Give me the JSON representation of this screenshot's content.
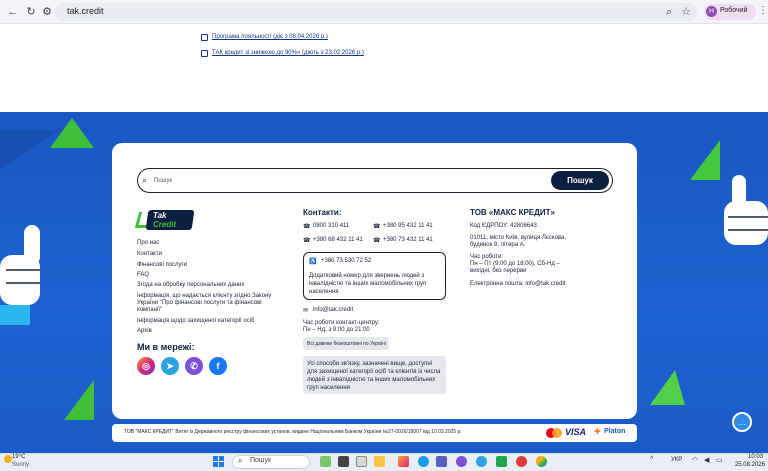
{
  "browser": {
    "url": "tak.credit",
    "profile_initial": "Н",
    "profile_name": "Робочий"
  },
  "top_links": [
    "Програма лояльності (діє з 08.04.2026 р.)",
    "ТАК кредит зі знижкою до 90%» (діють з 23.02.2026 р.)"
  ],
  "search": {
    "placeholder": "Пошук",
    "button_label": "Пошук"
  },
  "logo": {
    "line1": "Tak",
    "line2": "Credit"
  },
  "nav_links": [
    "Про нас",
    "Контакти",
    "Фінансові послуги",
    "FAQ",
    "Згода на обробку персональних даних",
    "Інформація, що надається клієнту згідно Закону України \"Про фінансові послуги та фінансові компанії\"",
    "Інформація щодо захищеної категорії осіб",
    "Архів"
  ],
  "social": {
    "title": "Ми в мережі:",
    "icons": [
      "instagram-icon",
      "telegram-icon",
      "viber-icon",
      "facebook-icon"
    ]
  },
  "contacts": {
    "title": "Контакти:",
    "phones": [
      "0800 310 411",
      "+380 95 432 11 41",
      "+380 68 432 11 41",
      "+380 73 432 11 41"
    ],
    "accessible_phone": "+380 73 530 72 52",
    "accessible_note": "Додатковий номер для звернень людей з інвалідністю та інших маломобільних груп населення",
    "email": "info@tak.credit",
    "hours_label": "Час роботи контакт-центру:",
    "hours": "Пн – Нд, з 9:00 до 21:00",
    "free_calls": "Всі дзвінки безкоштовні по Україні",
    "protected_note": "Усі способи зв'язку, зазначені вище, доступні для захищеної категорії осіб та клієнтів із числа людей з інвалідністю та інших маломобільних груп населення"
  },
  "company": {
    "title": "ТОВ «МАКС КРЕДИТ»",
    "edrpou": "Код ЄДРПОУ: 42806643",
    "address": "01011, місто Київ, вулиця Лєскова, будинок 9, літера А.",
    "hours_label": "Час роботи:",
    "hours": "Пн – Пт (9:00 до 18:00), Сб-Нд – вихідні, без перерви",
    "email": "Електронна пошта: info@tak.credit"
  },
  "footer": {
    "registry": "ТОВ \"МАКС КРЕДИТ\" Витяг із Державного реєстру фінансових установ, видане Національним Банком України №27-0026/18007 від 10.03.2025 р.",
    "visa": "VISA",
    "platon": "Platon"
  },
  "taskbar": {
    "temp": "19°C",
    "weather": "Sunny",
    "search": "Пошук",
    "lang": "УКР",
    "time": "10:03",
    "date": "25.08.2026"
  },
  "colors": {
    "brand_blue": "#1d62d1",
    "navy": "#0d1f3f",
    "green": "#3fbf3a"
  }
}
